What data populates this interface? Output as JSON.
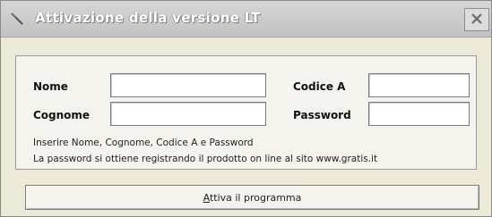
{
  "window": {
    "title": "Attivazione della versione LT",
    "icon": "app-feather-icon",
    "close_icon": "close-icon"
  },
  "form": {
    "nome_label": "Nome",
    "cognome_label": "Cognome",
    "codice_label": "Codice A",
    "password_label": "Password",
    "nome_value": "",
    "cognome_value": "",
    "codice_value": "",
    "password_value": ""
  },
  "info": {
    "line1": "Inserire Nome, Cognome, Codice A e Password",
    "line2": "La password si ottiene registrando il prodotto on line al sito www.gratis.it"
  },
  "actions": {
    "activate_label": "Attiva il programma"
  }
}
